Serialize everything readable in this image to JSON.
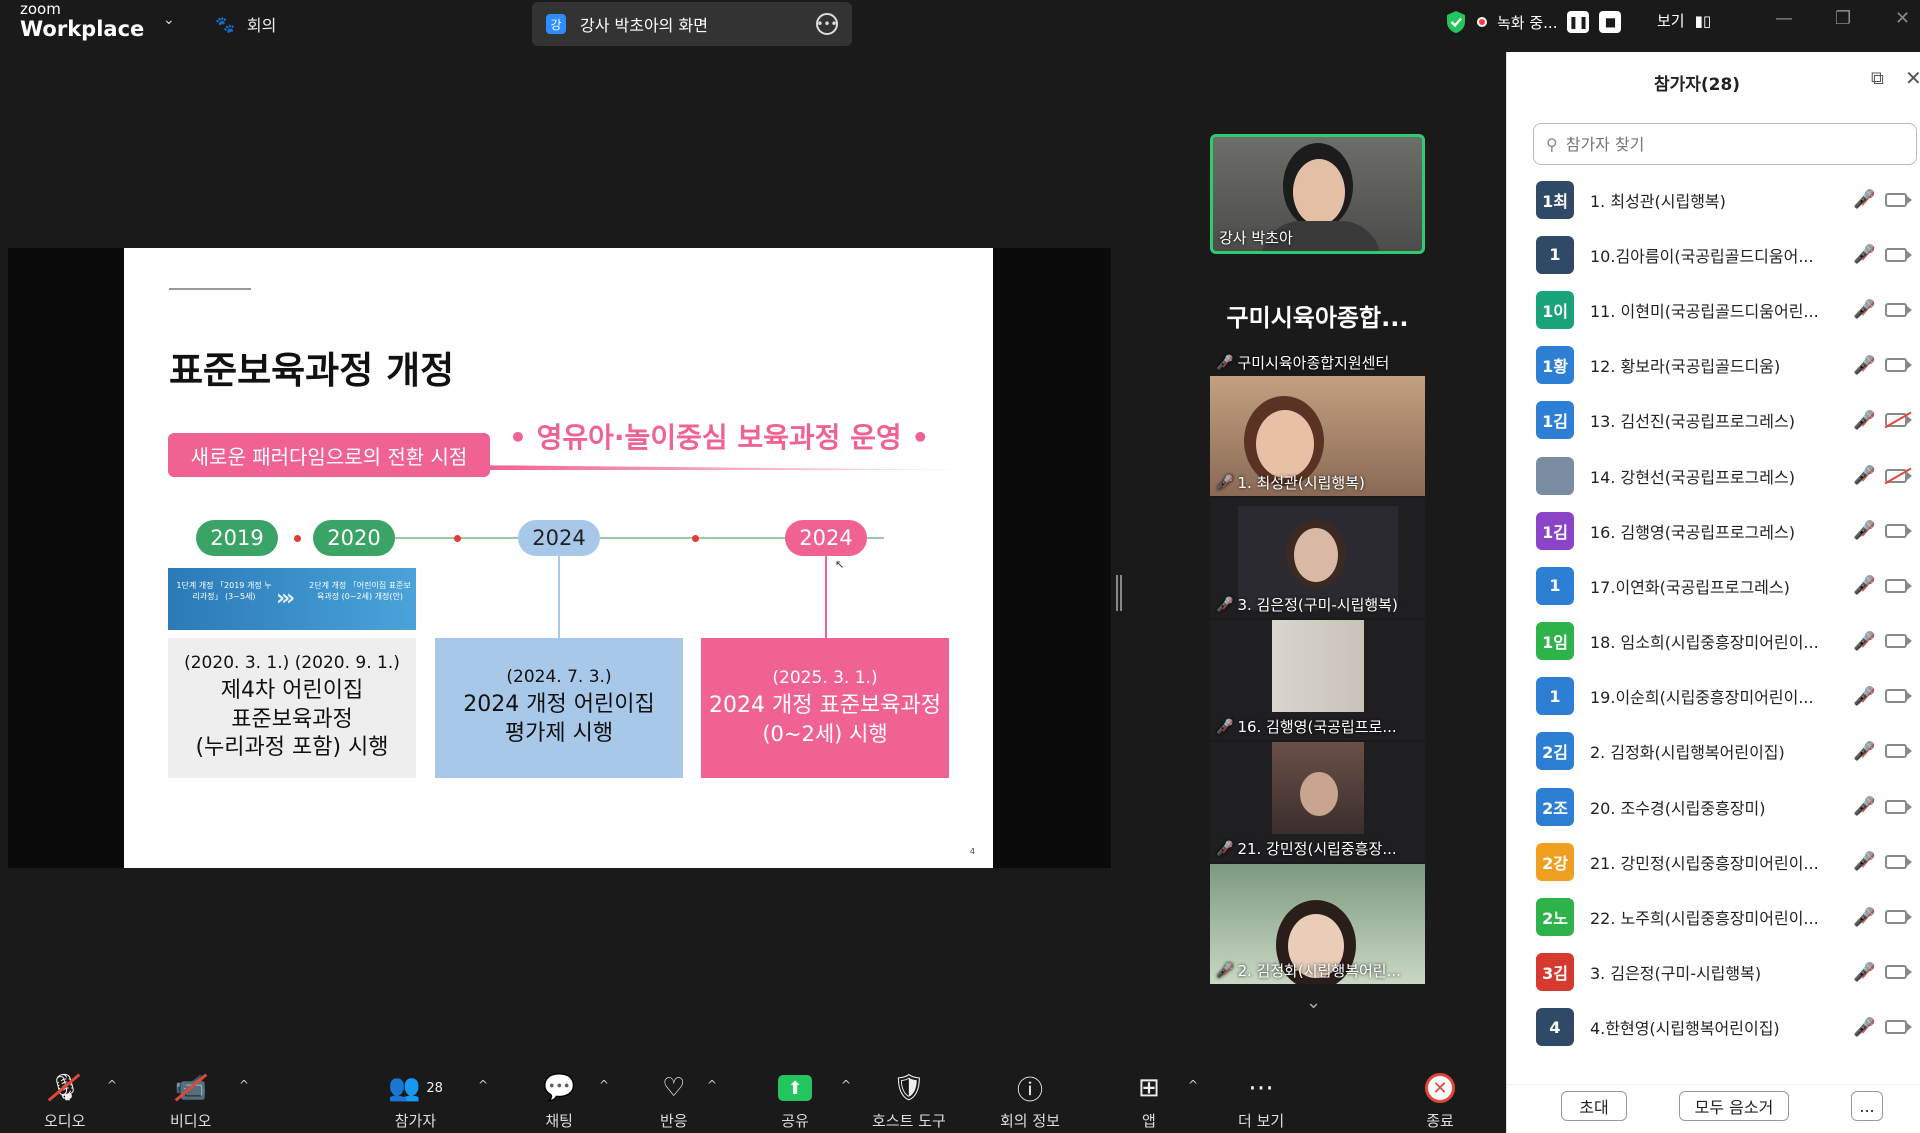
{
  "topbar": {
    "logo_small": "zoom",
    "logo_big": "Workplace",
    "meeting_label": "회의",
    "share_avatar": "강",
    "share_title": "강사 박초아의 화면",
    "recording_label": "녹화 중...",
    "view_label": "보기"
  },
  "slide": {
    "title": "표준보육과정 개정",
    "tag": "새로운 패러다임으로의 전환 시점",
    "slogan": "• 영유아·놀이중심 보육과정 운영 •",
    "years": [
      "2019",
      "2020",
      "2024",
      "2024"
    ],
    "banner_left": "1단계 개정\n「2019 개정 누리과정」\n(3~5세)",
    "banner_right": "2단계 개정\n「어린이집 표준보육과정\n(0~2세) 개정(안)",
    "box1_date": "(2020. 3. 1.) (2020. 9. 1.)",
    "box1_text": "제4차 어린이집\n표준보육과정\n(누리과정 포함) 시행",
    "box2_date": "(2024. 7. 3.)",
    "box2_text": "2024 개정 어린이집\n평가제 시행",
    "box3_date": "(2025. 3. 1.)",
    "box3_text": "2024 개정 표준보육과정",
    "box3_sub": "(0~2세) 시행",
    "page_number": "4"
  },
  "videos": {
    "host": "강사 박초아",
    "name_tile_big": "구미시육아종합...",
    "name_tile_small": "구미시육아종합지원센터",
    "v1": "1. 최성관(시립행복)",
    "v2": "3. 김은정(구미-시립행복)",
    "v3": "16. 김행영(국공립프로...",
    "v4": "21. 강민정(시립중흥장...",
    "v5": "2. 김정화(시립행복어린..."
  },
  "panel": {
    "title": "참가자(28)",
    "search_placeholder": "참가자 찾기",
    "participants": [
      {
        "avatar": "1최",
        "color": "#2f4a66",
        "name": "1. 최성관(시립행복)",
        "cam_off": false
      },
      {
        "avatar": "1",
        "color": "#2f4a66",
        "name": "10.김아름이(국공립골드디움어...",
        "cam_off": false
      },
      {
        "avatar": "1이",
        "color": "#1aa37a",
        "name": "11. 이현미(국공립골드디움어린...",
        "cam_off": false
      },
      {
        "avatar": "1황",
        "color": "#2d7fd6",
        "name": "12. 황보라(국공립골드디움)",
        "cam_off": false
      },
      {
        "avatar": "1김",
        "color": "#2d7fd6",
        "name": "13. 김선진(국공립프로그레스)",
        "cam_off": true
      },
      {
        "avatar": "",
        "color": "#7a8da3",
        "name": "14. 강현선(국공립프로그레스)",
        "cam_off": true
      },
      {
        "avatar": "1김",
        "color": "#8b44c7",
        "name": "16. 김행영(국공립프로그레스)",
        "cam_off": false
      },
      {
        "avatar": "1",
        "color": "#2d7fd6",
        "name": "17.이연화(국공립프로그레스)",
        "cam_off": false
      },
      {
        "avatar": "1임",
        "color": "#2db34a",
        "name": "18. 임소희(시립중흥장미어린이...",
        "cam_off": false
      },
      {
        "avatar": "1",
        "color": "#2d7fd6",
        "name": "19.이순희(시립중흥장미어린이...",
        "cam_off": false
      },
      {
        "avatar": "2김",
        "color": "#2d7fd6",
        "name": "2. 김정화(시립행복어린이집)",
        "cam_off": false
      },
      {
        "avatar": "2조",
        "color": "#2d7fd6",
        "name": "20. 조수경(시립중흥장미)",
        "cam_off": false
      },
      {
        "avatar": "2강",
        "color": "#f0a020",
        "name": "21. 강민정(시립중흥장미어린이...",
        "cam_off": false
      },
      {
        "avatar": "2노",
        "color": "#2db34a",
        "name": "22. 노주희(시립중흥장미어린이...",
        "cam_off": false
      },
      {
        "avatar": "3김",
        "color": "#d63a2f",
        "name": "3. 김은정(구미-시립행복)",
        "cam_off": false
      },
      {
        "avatar": "4",
        "color": "#2f4a66",
        "name": "4.한현영(시립행복어린이집)",
        "cam_off": false
      }
    ],
    "invite_label": "초대",
    "mute_all_label": "모두 음소거",
    "more_label": "..."
  },
  "toolbar": {
    "audio": "오디오",
    "video": "비디오",
    "participants": "참가자",
    "participants_count": "28",
    "chat": "채팅",
    "reactions": "반응",
    "share": "공유",
    "host_tools": "호스트 도구",
    "meeting_info": "회의 정보",
    "apps": "앱",
    "more": "더 보기",
    "end": "종료"
  }
}
